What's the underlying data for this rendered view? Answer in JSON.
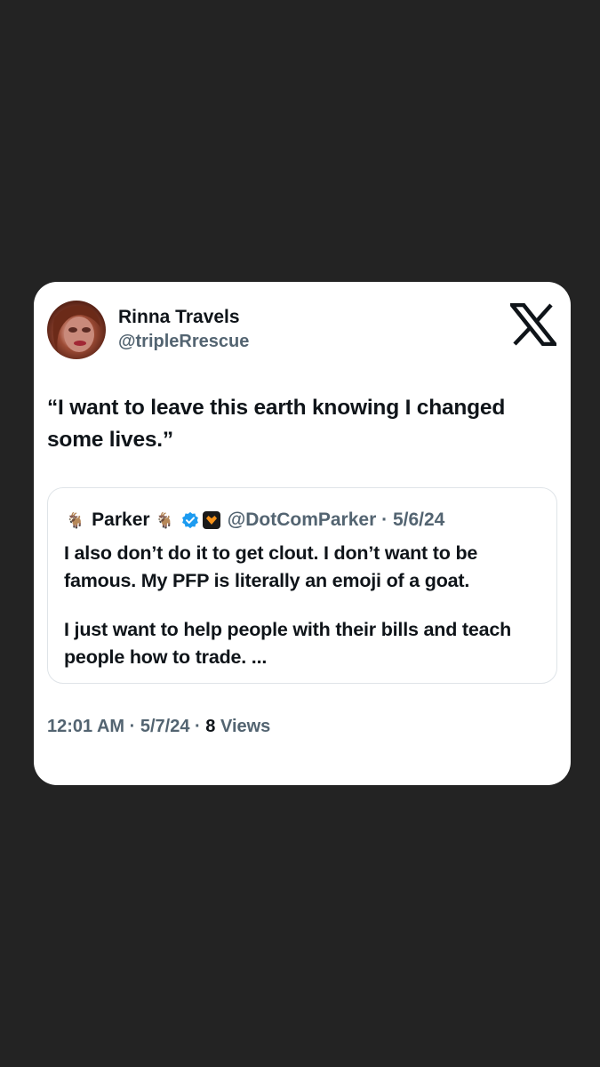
{
  "tweet": {
    "author_name": "Rinna Travels",
    "author_handle": "@tripleRrescue",
    "text": "“I want to leave this earth knowing I changed some lives.”",
    "time": "12:01 AM",
    "date": "5/7/24",
    "views_count": "8",
    "views_label": "Views",
    "separator": "·"
  },
  "quoted_tweet": {
    "name_prefix_emoji": "🐐",
    "name": "Parker",
    "name_suffix_emoji": "🐐",
    "handle": "@DotComParker",
    "date": "5/6/24",
    "paragraph_1": "I also don’t do it to get clout. I don’t want to be famous. My PFP is literally an emoji of a goat.",
    "paragraph_2": "I just want to help people with their bills and teach people how to trade. ..."
  },
  "icons": {
    "logo": "x-logo-icon",
    "verified": "verified-badge-icon",
    "affiliate": "affiliate-badge-icon"
  },
  "colors": {
    "background": "#232323",
    "card": "#ffffff",
    "text_primary": "#0f1419",
    "text_secondary": "#536471",
    "verified_blue": "#1d9bf0",
    "affiliate_orange": "#f7931a"
  }
}
